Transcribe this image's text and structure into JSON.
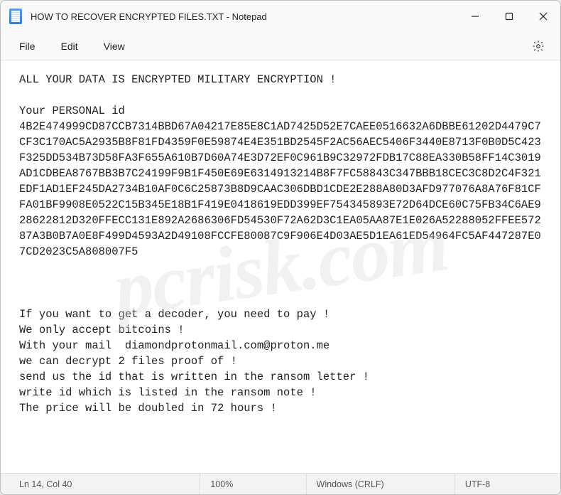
{
  "window": {
    "title": "HOW TO RECOVER ENCRYPTED FILES.TXT - Notepad"
  },
  "menu": {
    "file": "File",
    "edit": "Edit",
    "view": "View"
  },
  "document": {
    "body": "ALL YOUR DATA IS ENCRYPTED MILITARY ENCRYPTION !\n\nYour PERSONAL id\n4B2E474999CD87CCB7314BBD67A04217E85E8C1AD7425D52E7CAEE0516632A6DBBE61202D4479C7CF3C170AC5A2935B8F81FD4359F0E59874E4E351BD2545F2AC56AEC5406F3440E8713F0B0D5C423F325DD534B73D58FA3F655A610B7D60A74E3D72EF0C961B9C32972FDB17C88EA330B58FF14C3019AD1CDBEA8767BB3B7C24199F9B1F450E69E6314913214B8F7FC58843C347BBB18CEC3C8D2C4F321EDF1AD1EF245DA2734B10AF0C6C25873B8D9CAAC306DBD1CDE2E288A80D3AFD977076A8A76F81CFFA01BF9908E0522C15B345E18B1F419E0418619EDD399EF754345893E72D64DCE60C75FB34C6AE928622812D320FFECC131E892A2686306FD54530F72A62D3C1EA05AA87E1E026A52288052FFEE57287A3B0B7A0E8F499D4593A2D49108FCCFE80087C9F906E4D03AE5D1EA61ED54964FC5AF447287E07CD2023C5A808007F5\n\n\n\nIf you want to get a decoder, you need to pay !\nWe only accept bitcoins !\nWith your mail  diamondprotonmail.com@proton.me\nwe can decrypt 2 files proof of !\nsend us the id that is written in the ransom letter !\nwrite id which is listed in the ransom note !\nThe price will be doubled in 72 hours !"
  },
  "status": {
    "position": "Ln 14, Col 40",
    "zoom": "100%",
    "eol": "Windows (CRLF)",
    "encoding": "UTF-8"
  },
  "watermark": "pcrisk.com"
}
